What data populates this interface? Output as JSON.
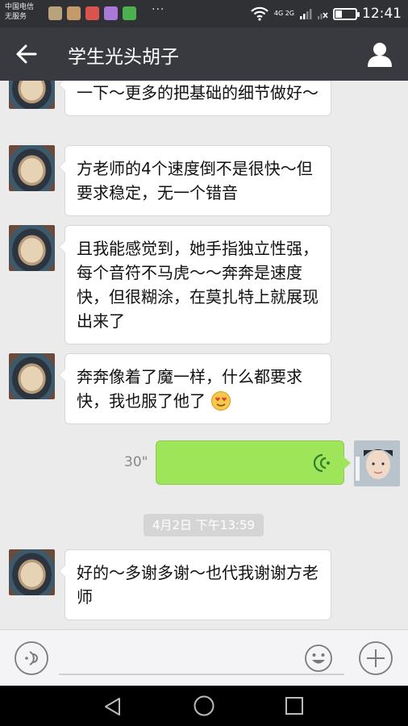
{
  "status_bar": {
    "carrier_line1": "中国电信",
    "carrier_line2": "无服务",
    "network_label": "4G 2G",
    "time": "12:41",
    "battery_level": 0.35,
    "app_icon_colors": [
      "#b8a37c",
      "#c59a6a",
      "#d9534f",
      "#a879d6",
      "#4caf50"
    ],
    "dots": "···"
  },
  "header": {
    "back_icon": "back-arrow-icon",
    "title": "学生光头胡子",
    "profile_icon": "person-icon"
  },
  "messages": [
    {
      "sender": "other",
      "text": "一下～更多的把基础的细节做好～"
    },
    {
      "sender": "other",
      "text": "方老师的4个速度倒不是很快～但要求稳定，无一个错音"
    },
    {
      "sender": "other",
      "text": "且我能感觉到，她手指独立性强，每个音符不马虎～～奔奔是速度快，但很糊涂，在莫扎特上就展现出来了"
    },
    {
      "sender": "other",
      "text": "奔奔像着了魔一样，什么都要求快，我也服了他了",
      "emoji": "heart-eyes-emoji-icon"
    },
    {
      "sender": "self",
      "type": "voice",
      "duration": "30\"",
      "icon": "voice-wave-icon"
    },
    {
      "type": "timestamp",
      "text": "4月2日 下午13:59"
    },
    {
      "sender": "other",
      "text": "好的～多谢多谢～也代我谢谢方老师"
    }
  ],
  "input_bar": {
    "voice_toggle_icon": "voice-input-icon",
    "placeholder": "",
    "emoji_icon": "smiley-icon",
    "more_icon": "plus-icon"
  },
  "nav_bar": {
    "back_icon": "triangle-back-icon",
    "home_icon": "circle-home-icon",
    "recent_icon": "square-recent-icon"
  },
  "colors": {
    "status_bar_bg": "#2f3135",
    "title_bar_bg": "#393a3f",
    "chat_bg": "#ebebeb",
    "self_bubble": "#9fe55a"
  }
}
